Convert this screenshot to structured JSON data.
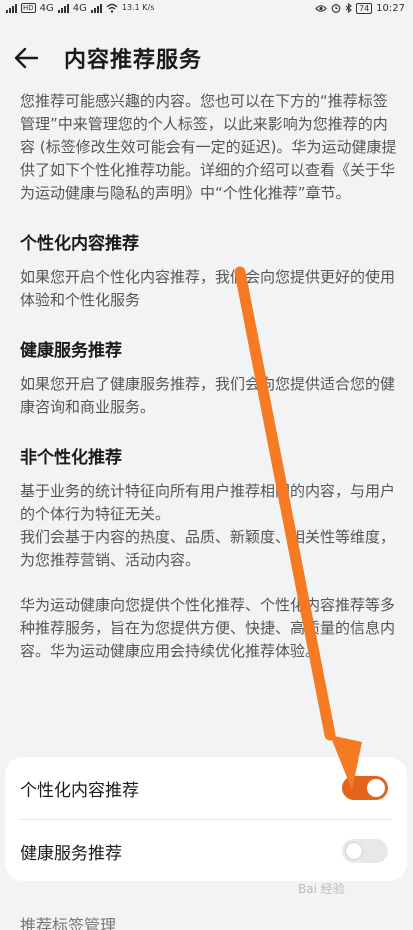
{
  "status_bar": {
    "left_network_1": "4G",
    "left_network_2": "4G",
    "speed": "13.1 K/s",
    "battery": "74",
    "time": "10:27"
  },
  "header": {
    "title": "内容推荐服务"
  },
  "intro": "您推荐可能感兴趣的内容。您也可以在下方的“推荐标签管理”中来管理您的个人标签，以此来影响为您推荐的内容 (标签修改生效可能会有一定的延迟)。华为运动健康提供了如下个性化推荐功能。详细的介绍可以查看《关于华为运动健康与隐私的声明》中“个性化推荐”章节。",
  "sections": [
    {
      "title": "个性化内容推荐",
      "body": [
        "如果您开启个性化内容推荐，我们会向您提供更好的使用体验和个性化服务"
      ]
    },
    {
      "title": "健康服务推荐",
      "body": [
        "如果您开启了健康服务推荐，我们会向您提供适合您的健康咨询和商业服务。"
      ]
    },
    {
      "title": "非个性化推荐",
      "body": [
        "基于业务的统计特征向所有用户推荐相同的内容，与用户的个体行为特征无关。",
        "我们会基于内容的热度、品质、新颖度、相关性等维度，为您推荐营销、活动内容。"
      ]
    }
  ],
  "note": "华为运动健康向您提供个性化推荐、个性化内容推荐等多种推荐服务，旨在为您提供方便、快捷、高质量的信息内容。华为运动健康应用会持续优化推荐体验。",
  "settings": [
    {
      "label": "个性化内容推荐",
      "state": "on"
    },
    {
      "label": "健康服务推荐",
      "state": "off"
    }
  ],
  "footer_label": "推荐标签管理",
  "watermark": "Bai 经验",
  "colors": {
    "accent": "#e3651b",
    "annotation_arrow": "#f57a22",
    "background": "#f1f3f5"
  }
}
